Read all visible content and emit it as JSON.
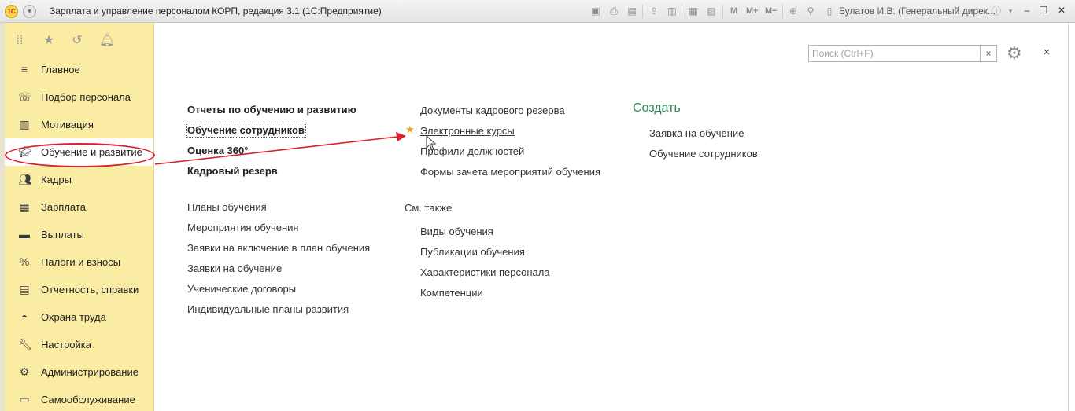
{
  "titlebar": {
    "logo": "1С",
    "title": "Зарплата и управление персоналом КОРП, редакция 3.1  (1С:Предприятие)",
    "tools": [
      "save-icon",
      "print-icon",
      "preview-icon",
      "upload-icon",
      "scan-icon",
      "calc-icon",
      "calendar-icon"
    ],
    "memory_buttons": [
      "M",
      "M+",
      "M−"
    ],
    "user": "Булатов И.В. (Генеральный дирек..."
  },
  "sidebar": {
    "top_icons": [
      "apps-icon",
      "star-icon",
      "history-icon",
      "bell-icon"
    ],
    "items": [
      {
        "label": "Главное",
        "icon": "menu-icon"
      },
      {
        "label": "Подбор персонала",
        "icon": "phone-icon"
      },
      {
        "label": "Мотивация",
        "icon": "gift-icon"
      },
      {
        "label": "Обучение и развитие",
        "icon": "graduation-icon"
      },
      {
        "label": "Кадры",
        "icon": "people-icon"
      },
      {
        "label": "Зарплата",
        "icon": "calculator-icon"
      },
      {
        "label": "Выплаты",
        "icon": "card-icon"
      },
      {
        "label": "Налоги и взносы",
        "icon": "percent-icon"
      },
      {
        "label": "Отчетность, справки",
        "icon": "document-icon"
      },
      {
        "label": "Охрана труда",
        "icon": "helmet-icon"
      },
      {
        "label": "Настройка",
        "icon": "wrench-icon"
      },
      {
        "label": "Администрирование",
        "icon": "gear-icon"
      },
      {
        "label": "Самообслуживание",
        "icon": "id-card-icon"
      }
    ],
    "active": "Обучение и развитие"
  },
  "search": {
    "placeholder": "Поиск (Ctrl+F)",
    "clear": "×"
  },
  "close_label": "×",
  "col1": {
    "bold_links": [
      "Отчеты по обучению и развитию",
      "Обучение сотрудников",
      "Оценка 360°",
      "Кадровый резерв"
    ],
    "links": [
      "Планы обучения",
      "Мероприятия обучения",
      "Заявки на включение в план обучения",
      "Заявки на обучение",
      "Ученические договоры",
      "Индивидуальные планы развития"
    ]
  },
  "col2": {
    "links": [
      "Документы кадрового резерва",
      "Электронные курсы",
      "Профили должностей",
      "Формы зачета мероприятий обучения"
    ],
    "see_also_header": "См. также",
    "see_also": [
      "Виды обучения",
      "Публикации обучения",
      "Характеристики персонала",
      "Компетенции"
    ]
  },
  "create": {
    "header": "Создать",
    "links": [
      "Заявка на обучение",
      "Обучение сотрудников"
    ]
  },
  "colors": {
    "sidebar": "#fbeca4",
    "create_header": "#2d8a5a",
    "annotation": "#d9212a",
    "star": "#f0a020"
  }
}
